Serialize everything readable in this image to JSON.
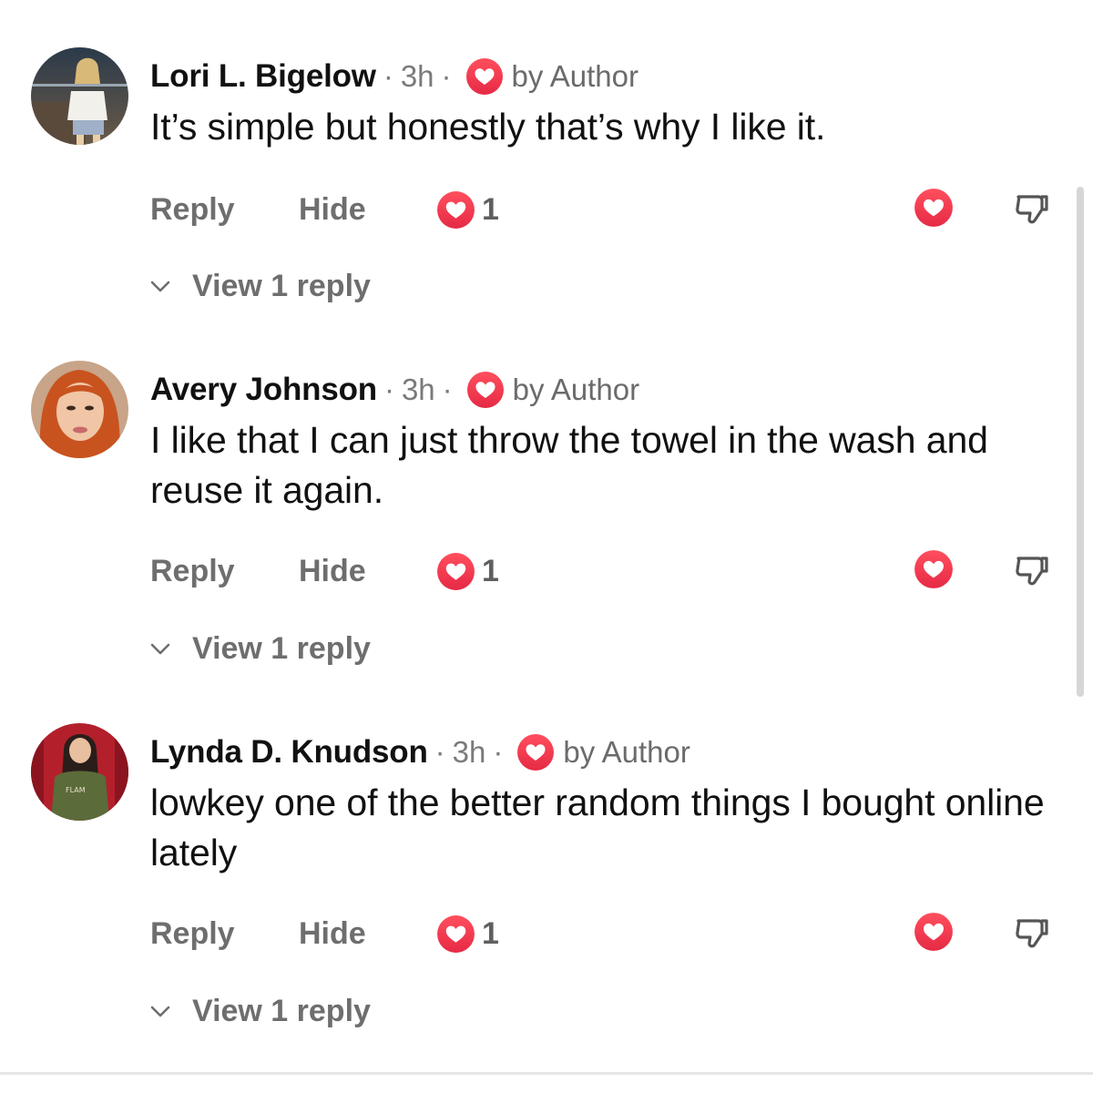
{
  "comments": [
    {
      "name": "Lori L. Bigelow",
      "time": "3h",
      "dot": "·",
      "author_badge": "by Author",
      "text": "It’s simple but honestly that’s why I like it.",
      "reply_label": "Reply",
      "hide_label": "Hide",
      "like_count": "1",
      "view_replies": "View 1 reply"
    },
    {
      "name": "Avery Johnson",
      "time": "3h",
      "dot": "·",
      "author_badge": "by Author",
      "text": "I like that I can just throw the towel in the wash and reuse it again.",
      "reply_label": "Reply",
      "hide_label": "Hide",
      "like_count": "1",
      "view_replies": "View 1 reply"
    },
    {
      "name": "Lynda D. Knudson",
      "time": "3h",
      "dot": "·",
      "author_badge": "by Author",
      "text": "lowkey one of the better random things I bought online lately",
      "reply_label": "Reply",
      "hide_label": "Hide",
      "like_count": "1",
      "view_replies": "View 1 reply"
    }
  ],
  "avatar_shirt_text": "FLAM",
  "colors": {
    "heart": "#f0384b",
    "meta_gray": "#7a7a7a",
    "action_gray": "#6e6e6e"
  },
  "icons": [
    "heart-icon",
    "thumbs-down-icon",
    "chevron-down-icon"
  ]
}
